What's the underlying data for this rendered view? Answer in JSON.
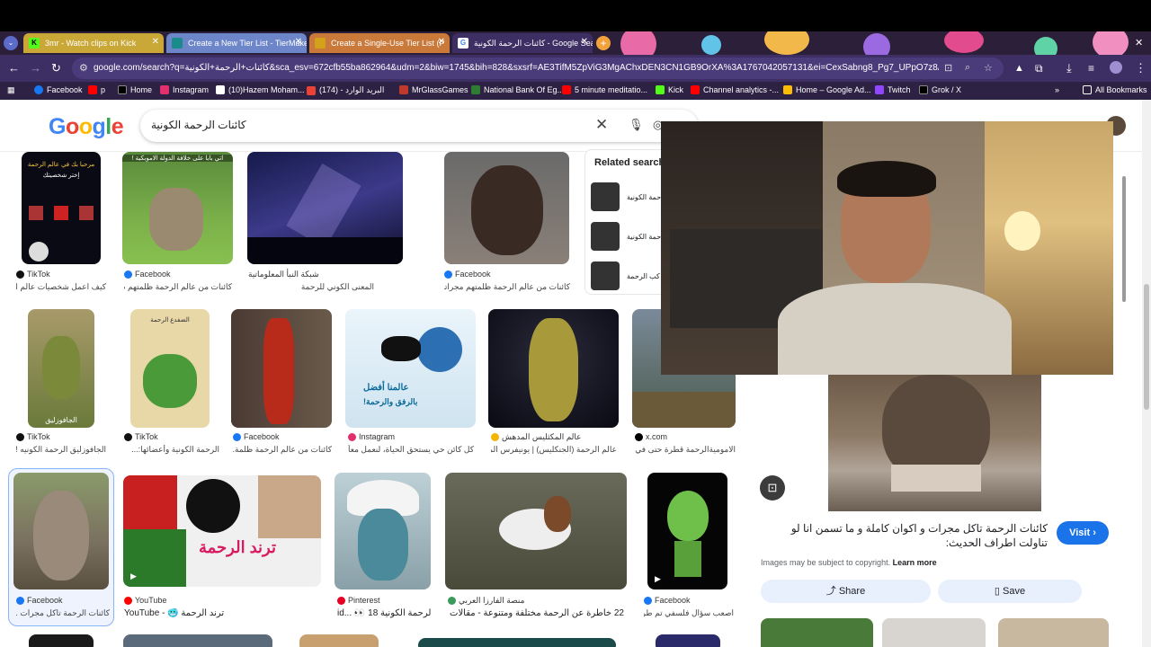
{
  "browser": {
    "tabs": [
      {
        "label": "3mr - Watch clips on Kick",
        "active": false
      },
      {
        "label": "Create a New Tier List - TierMaker",
        "active": false
      },
      {
        "label": "Create a Single-Use Tier List (P",
        "active": false
      },
      {
        "label": "كائنات الرحمة الكونية - Google Search",
        "active": true
      }
    ],
    "url": "google.com/search?q=كائنات+الرحمة+الكونية&sca_esv=672cfb55ba862964&udm=2&biw=1745&bih=828&sxsrf=AE3TifM5ZpViG3MgAChxDEN3CN1GB9OrXA%3A1767042057131&ei=CexSabng8_Pg7_UPpO7z8Aw&ved=0ahUK...",
    "bookmarks": [
      "Facebook",
      "p",
      "Home",
      "Instagram",
      "(10)Hazem Moham...",
      "(174) - البريد الوارد",
      "MrGlassGames",
      "National Bank Of Eg...",
      "5 minute meditatio...",
      "Kick",
      "Channel analytics -...",
      "Home – Google Ad...",
      "Twitch",
      "Grok / X"
    ],
    "all_bookmarks": "All Bookmarks",
    "more": "»"
  },
  "google": {
    "logo": "Google",
    "query": "كائنات الرحمة الكونية"
  },
  "results": [
    {
      "source": "TikTok",
      "title": "كيف اعمل شخصيات عالم ا..."
    },
    {
      "source": "Facebook",
      "title": "كائنات من عالم الرحمة ظلمتهم م..."
    },
    {
      "source": "شبكة النبأ المعلوماتية",
      "title": "المعنى الكوني للرحمة"
    },
    {
      "source": "Facebook",
      "title": "كائنات من عالم الرحمة ظلمتهم مجراته..."
    },
    {
      "source": "TikTok",
      "title": "الجافوزليق الرحمة الكونيه !..."
    },
    {
      "source": "TikTok",
      "title": "الرحمة الكونية وأعضائها:..."
    },
    {
      "source": "Facebook",
      "title": "كائنات من عالم الرحمة ظلمة..."
    },
    {
      "source": "Instagram",
      "title": "كل كائن حي يستحق الحياة، لنعمل معاً لـ..."
    },
    {
      "source": "عالم المكثليس المدهش",
      "title": "عالم الرحمة (الجنكليس) | يونيفرس المو..."
    },
    {
      "source": "x.com",
      "title": "الاموميةالرحمة قطرة حتى في..."
    },
    {
      "source": "Facebook",
      "title": "كائنات الرحمة تاكل مجرات ..."
    },
    {
      "source": "YouTube",
      "title": "YouTube - 🥶 ترند الرحمة"
    },
    {
      "source": "Pinterest",
      "title": "id... 👀 الرحمة الكونية 18"
    },
    {
      "source": "منصة الفارزا العربي",
      "title": "22 خاطرة عن الرحمة مختلفة ومتنوعة - مقالات | منصة..."
    },
    {
      "source": "Facebook",
      "title": "اصعب سؤال فلسفي تم طر..."
    }
  ],
  "thumb_text": {
    "t1": "مرحبا بك في عالم الرحمة",
    "t1b": "إختر شخصيتك",
    "t2": "اتي بابا على خلافة الدولة الاموبكية !",
    "t5": "الجافوزليق",
    "t6": "الضفدع الرحمة",
    "t8a": "عالمنا أفضل",
    "t8b": "بالرفق والرحمة!",
    "t12": "ترند الرحمة"
  },
  "related": {
    "title": "Related search",
    "items": [
      "حمة الكونية",
      "حمة الكونية",
      "كب الرحمة"
    ]
  },
  "panel": {
    "title": "كائنات الرحمة تاكل مجرات و اكوان كاملة و ما تسمن انا لو تناولت اطراف الحديث:",
    "visit": "Visit",
    "copyright": "Images may be subject to copyright.",
    "learn_more": "Learn more",
    "share": "Share",
    "save": "Save"
  },
  "colors": {
    "google_blue": "#4285F4",
    "google_red": "#EA4335",
    "google_yellow": "#FBBC05",
    "google_green": "#34A853",
    "visit_blue": "#1a73e8",
    "browser_accent": "#3d2e63"
  }
}
